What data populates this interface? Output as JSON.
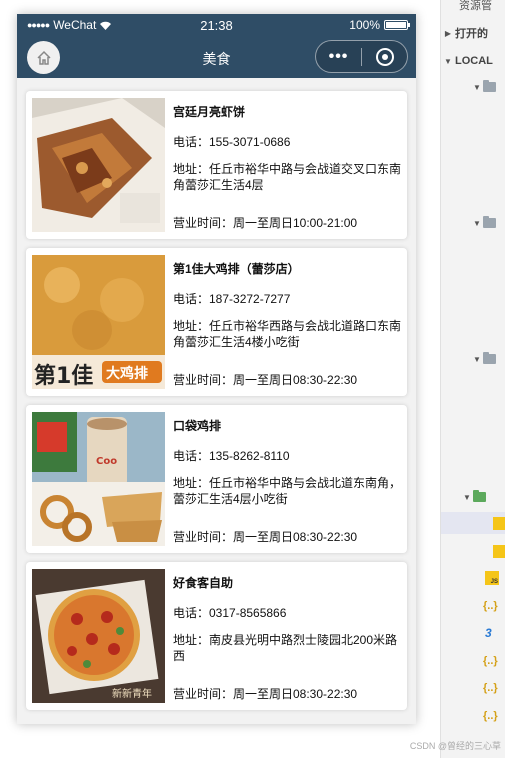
{
  "status": {
    "carrier": "WeChat",
    "time": "21:38",
    "battery": "100%",
    "battery_level": 1.0
  },
  "nav": {
    "title": "美食",
    "more": "•••"
  },
  "shops": [
    {
      "name": "宫廷月亮虾饼",
      "phone": "电话：155-3071-0686",
      "address": "地址：任丘市裕华中路与会战道交叉口东南角蕾莎汇生活4层",
      "hours": "营业时间：周一至周日10:00-21:00"
    },
    {
      "name": "第1佳大鸡排（蕾莎店）",
      "phone": "电话：187-3272-7277",
      "address": "地址：任丘市裕华西路与会战北道路口东南角蕾莎汇生活4楼小吃街",
      "hours": "营业时间：周一至周日08:30-22:30"
    },
    {
      "name": "口袋鸡排",
      "phone": "电话：135-8262-8110",
      "address": "地址：任丘市裕华中路与会战北道东南角，蕾莎汇生活4层小吃街",
      "hours": "营业时间：周一至周日08:30-22:30"
    },
    {
      "name": "好食客自助",
      "phone": "电话：0317-8565866",
      "address": "地址：南皮县光明中路烈士陵园北200米路西",
      "hours": "营业时间：周一至周日08:30-22:30"
    }
  ],
  "image_text": {
    "shop2_logo": "第1佳",
    "shop2_sign": "大鸡排",
    "shop3_cup": "Coo",
    "shop4_sign": "新新青年"
  },
  "ide": {
    "header": "资源管",
    "open_section": "打开的",
    "local_section": "LOCAL",
    "js_label": "JS",
    "brace": "{..}",
    "css_label": "3"
  },
  "watermark": "CSDN @曾经的三心草"
}
